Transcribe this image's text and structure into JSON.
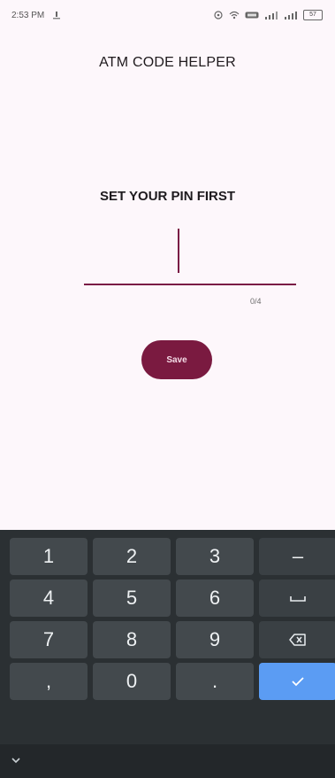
{
  "status_bar": {
    "time": "2:53 PM",
    "notification_icon": "data-usage-icon",
    "battery_level": "57",
    "icons": [
      "hotspot-icon",
      "wifi-icon",
      "vpn-icon",
      "signal-icon",
      "signal-icon",
      "battery-icon"
    ]
  },
  "app": {
    "title": "ATM CODE HELPER"
  },
  "main": {
    "prompt": "SET YOUR PIN FIRST",
    "pin": {
      "value": "",
      "counter": "0/4"
    },
    "save_label": "Save"
  },
  "colors": {
    "accent": "#7a1a40",
    "background": "#fdf7fb",
    "keyboard_bg": "#2b3033",
    "key_bg": "#43494d",
    "done_key": "#5b9cf3"
  },
  "keyboard": {
    "rows": [
      [
        "1",
        "2",
        "3",
        "-"
      ],
      [
        "4",
        "5",
        "6",
        "space"
      ],
      [
        "7",
        "8",
        "9",
        "backspace"
      ],
      [
        ",",
        "0",
        ".",
        "done"
      ]
    ],
    "keys": {
      "k1": "1",
      "k2": "2",
      "k3": "3",
      "minus": "–",
      "k4": "4",
      "k5": "5",
      "k6": "6",
      "k7": "7",
      "k8": "8",
      "k9": "9",
      "comma": ",",
      "k0": "0",
      "period": "."
    },
    "icons": {
      "space": "space-bar-icon",
      "backspace": "backspace-icon",
      "done": "checkmark-icon",
      "collapse": "chevron-down-icon"
    }
  }
}
